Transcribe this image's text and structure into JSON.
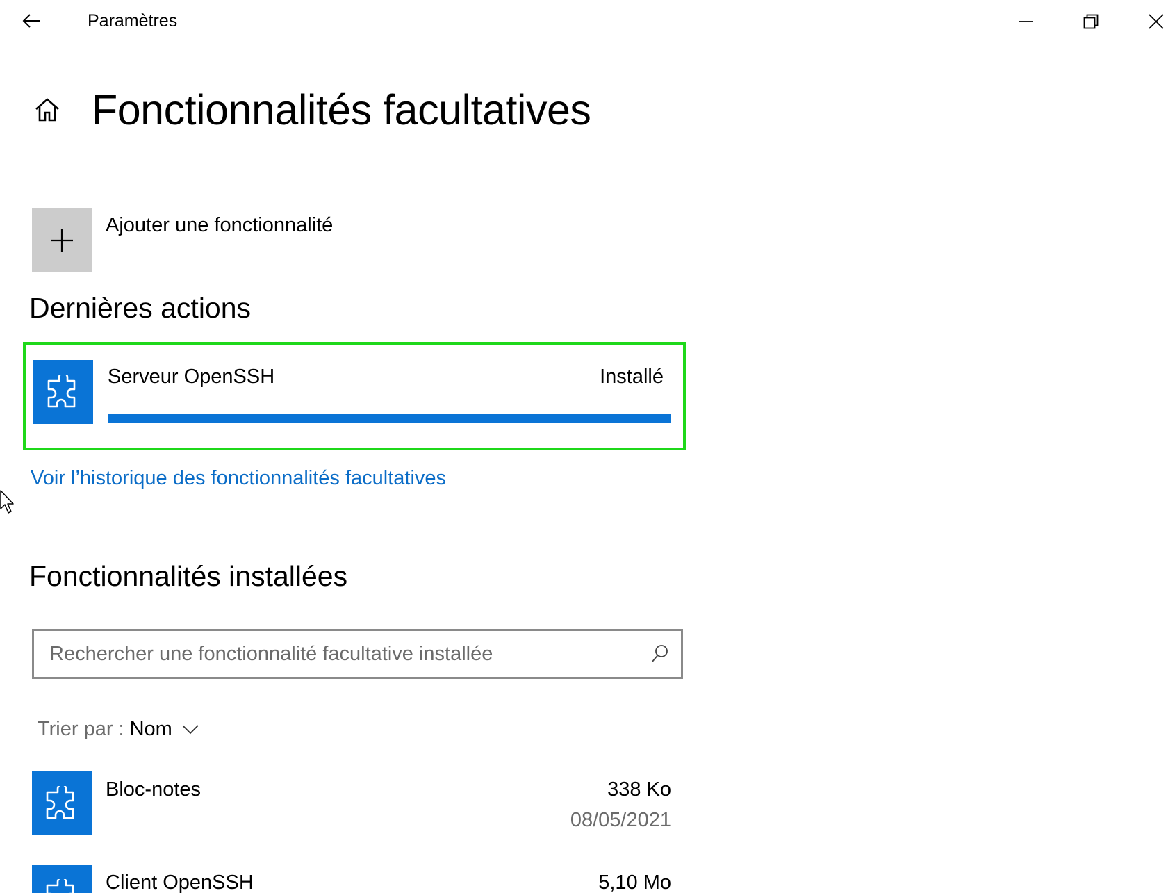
{
  "window": {
    "title": "Paramètres",
    "back_icon": "arrow-left-icon",
    "controls": [
      "minimize-icon",
      "restore-icon",
      "close-icon"
    ]
  },
  "header": {
    "icon": "home-icon",
    "title": "Fonctionnalités facultatives"
  },
  "add_feature": {
    "icon": "plus-icon",
    "label": "Ajouter une fonctionnalité"
  },
  "recent": {
    "heading": "Dernières actions",
    "item": {
      "icon": "puzzle-icon",
      "name": "Serveur OpenSSH",
      "status": "Installé",
      "progress": 1.0
    },
    "history_link": "Voir l’historique des fonctionnalités facultatives"
  },
  "installed": {
    "heading": "Fonctionnalités installées",
    "search": {
      "placeholder": "Rechercher une fonctionnalité facultative installée",
      "icon": "search-icon"
    },
    "sort": {
      "prefix": "Trier par :",
      "value": "Nom"
    },
    "items": [
      {
        "icon": "puzzle-icon",
        "name": "Bloc-notes",
        "size": "338 Ko",
        "date": "08/05/2021"
      },
      {
        "icon": "puzzle-icon",
        "name": "Client OpenSSH",
        "size": "5,10 Mo",
        "date": ""
      }
    ]
  },
  "colors": {
    "accent": "#0a74d6",
    "link": "#0a6cc7",
    "highlight": "#1fd81a",
    "tile_grey": "#cccccc"
  }
}
